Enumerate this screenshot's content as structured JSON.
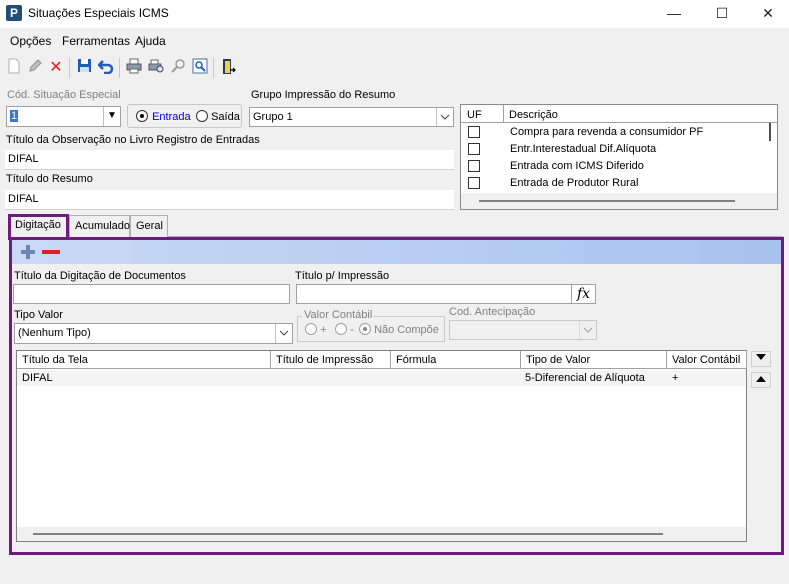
{
  "window": {
    "title": "Situações Especiais ICMS",
    "app_icon_letter": "P",
    "minimize": "—",
    "maximize": "☐",
    "close": "✕"
  },
  "menu": {
    "items": [
      "Opções",
      "Ferramentas",
      "Ajuda"
    ]
  },
  "toolbar": {
    "icons": [
      "new-icon",
      "edit-icon",
      "delete-icon",
      "save-icon",
      "undo-icon",
      "print-icon",
      "print-preview-icon",
      "search-icon",
      "zoom-icon",
      "exit-icon"
    ]
  },
  "form": {
    "cod_label": "Cód. Situação Especial",
    "cod_value": "1",
    "entrada_label": "Entrada",
    "saida_label": "Saída",
    "grupo_label": "Grupo Impressão do Resumo",
    "grupo_value": "Grupo 1",
    "titulo_obs_label": "Título da Observação no Livro Registro de Entradas",
    "titulo_obs_value": "DIFAL",
    "titulo_resumo_label": "Título do Resumo",
    "titulo_resumo_value": "DIFAL"
  },
  "uf_grid": {
    "headers": [
      "UF",
      "Descrição"
    ],
    "rows": [
      {
        "descricao": "Compra para revenda a consumidor PF"
      },
      {
        "descricao": "Entr.Interestadual Dif.Alíquota"
      },
      {
        "descricao": "Entrada com ICMS Diferido"
      },
      {
        "descricao": "Entrada de Produtor Rural"
      }
    ]
  },
  "tabs": [
    "Digitação",
    "Acumulado",
    "Geral"
  ],
  "digitacao": {
    "titulo_digitacao_label": "Título da Digitação de Documentos",
    "titulo_digitacao_value": "",
    "titulo_impressao_label": "Título p/ Impressão",
    "titulo_impressao_value": "",
    "fx_label": "fx",
    "tipo_valor_label": "Tipo Valor",
    "tipo_valor_value": "(Nenhum Tipo)",
    "valor_contabil_label": "Valor Contábil",
    "vc_plus": "+",
    "vc_minus": "-",
    "vc_nao_compoe": "Não Compõe",
    "cod_antecipacao_label": "Cod. Antecipação",
    "cod_antecipacao_value": ""
  },
  "doc_grid": {
    "headers": [
      "Título da Tela",
      "Título de Impressão",
      "Fórmula",
      "Tipo de Valor",
      "Valor Contábil"
    ],
    "rows": [
      {
        "titulo_tela": "DIFAL",
        "titulo_impressao": "",
        "formula": "",
        "tipo_valor": "5-Diferencial de Alíquota",
        "valor_contabil": "+"
      }
    ]
  },
  "colors": {
    "highlight_border": "#6e1a7e",
    "panel_bar": "#a8c2ee",
    "entrada_text": "#0000cc"
  }
}
